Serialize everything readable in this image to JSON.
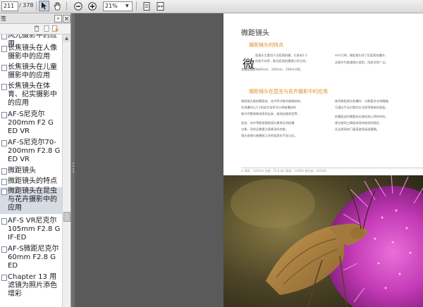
{
  "toolbar": {
    "current_page": "211",
    "total_pages": "/ 378",
    "zoom": "21%",
    "icons": [
      "select-tool-icon",
      "hand-tool-icon",
      "zoom-out-icon",
      "zoom-in-icon",
      "fit-page-icon",
      "fit-width-icon"
    ]
  },
  "sidebar": {
    "title": "签",
    "collapse_glyph": "«",
    "items": [
      {
        "text": "风光摄影中的应用"
      },
      {
        "text": "长焦镜头在人像摄影中的应用"
      },
      {
        "text": "长焦镜头在儿童摄影中的应用"
      },
      {
        "text": "长焦镜头在体育、纪实摄影中的应用"
      },
      {
        "text": "AF-S尼克尔200mm F2 G ED VR"
      },
      {
        "text": "AF-S尼克尔70-200mm F2.8 G ED VR"
      },
      {
        "text": "微距镜头"
      },
      {
        "text": "微距镜头的特点"
      },
      {
        "text": "微距镜头在昆虫与花卉摄影中的应用"
      },
      {
        "text": "AF-S VR尼克尔105mm F2.8 G IF-ED"
      },
      {
        "text": "AF-S微距尼克尔60mm F2.8 G ED"
      },
      {
        "text": "Chapter 13 用滤镜为照片添色增彩"
      }
    ]
  },
  "page": {
    "chapter_title": "微距镜头",
    "section1_title": "微距镜头的特点",
    "dropcap": "微",
    "section1_col1": [
      "距镜头主要用于近距离拍摄，它具有1:1",
      "的放大倍率，能近距离拍摄细小的主体，",
      "其焦距通常有60mm、105mm、200mm等。"
    ],
    "section1_col2": [
      "mm几种。微距镜头除了近距离拍摄外，",
      "还能作为普通镜头使用，用途非常广泛。"
    ],
    "section2_title": "微距镜头在昆虫与花卉摄影中的应用",
    "section2_col1": [
      "微距镜头能拍摄昆虫、花卉等对象的细微结构，",
      "在拍摄时以1:1的放大倍率可以将被摄体的",
      "细节完整清晰地表现出来，展现出微观世界。",
      "昆虫、花卉等都是微距镜头最常见的拍摄",
      "对象，同时还需要注意景深的控制，",
      "镜头前端与被摄体之间的距离也不宜过近。"
    ],
    "section2_col2": [
      "使用微距镜头拍摄时，对焦要求非常精确，",
      "可通过手动对焦的方式获得清晰的画面。",
      "拍摄昆虫时需要有足够的耐心等待时机，",
      "建议使用三脚架来保持相机的稳定，",
      "适当提高快门速度避免画面模糊。"
    ],
    "footer_text": "① 焦距：105mm  光圈：F5.6  快门速度：1/400s  感光度：ISO200"
  }
}
